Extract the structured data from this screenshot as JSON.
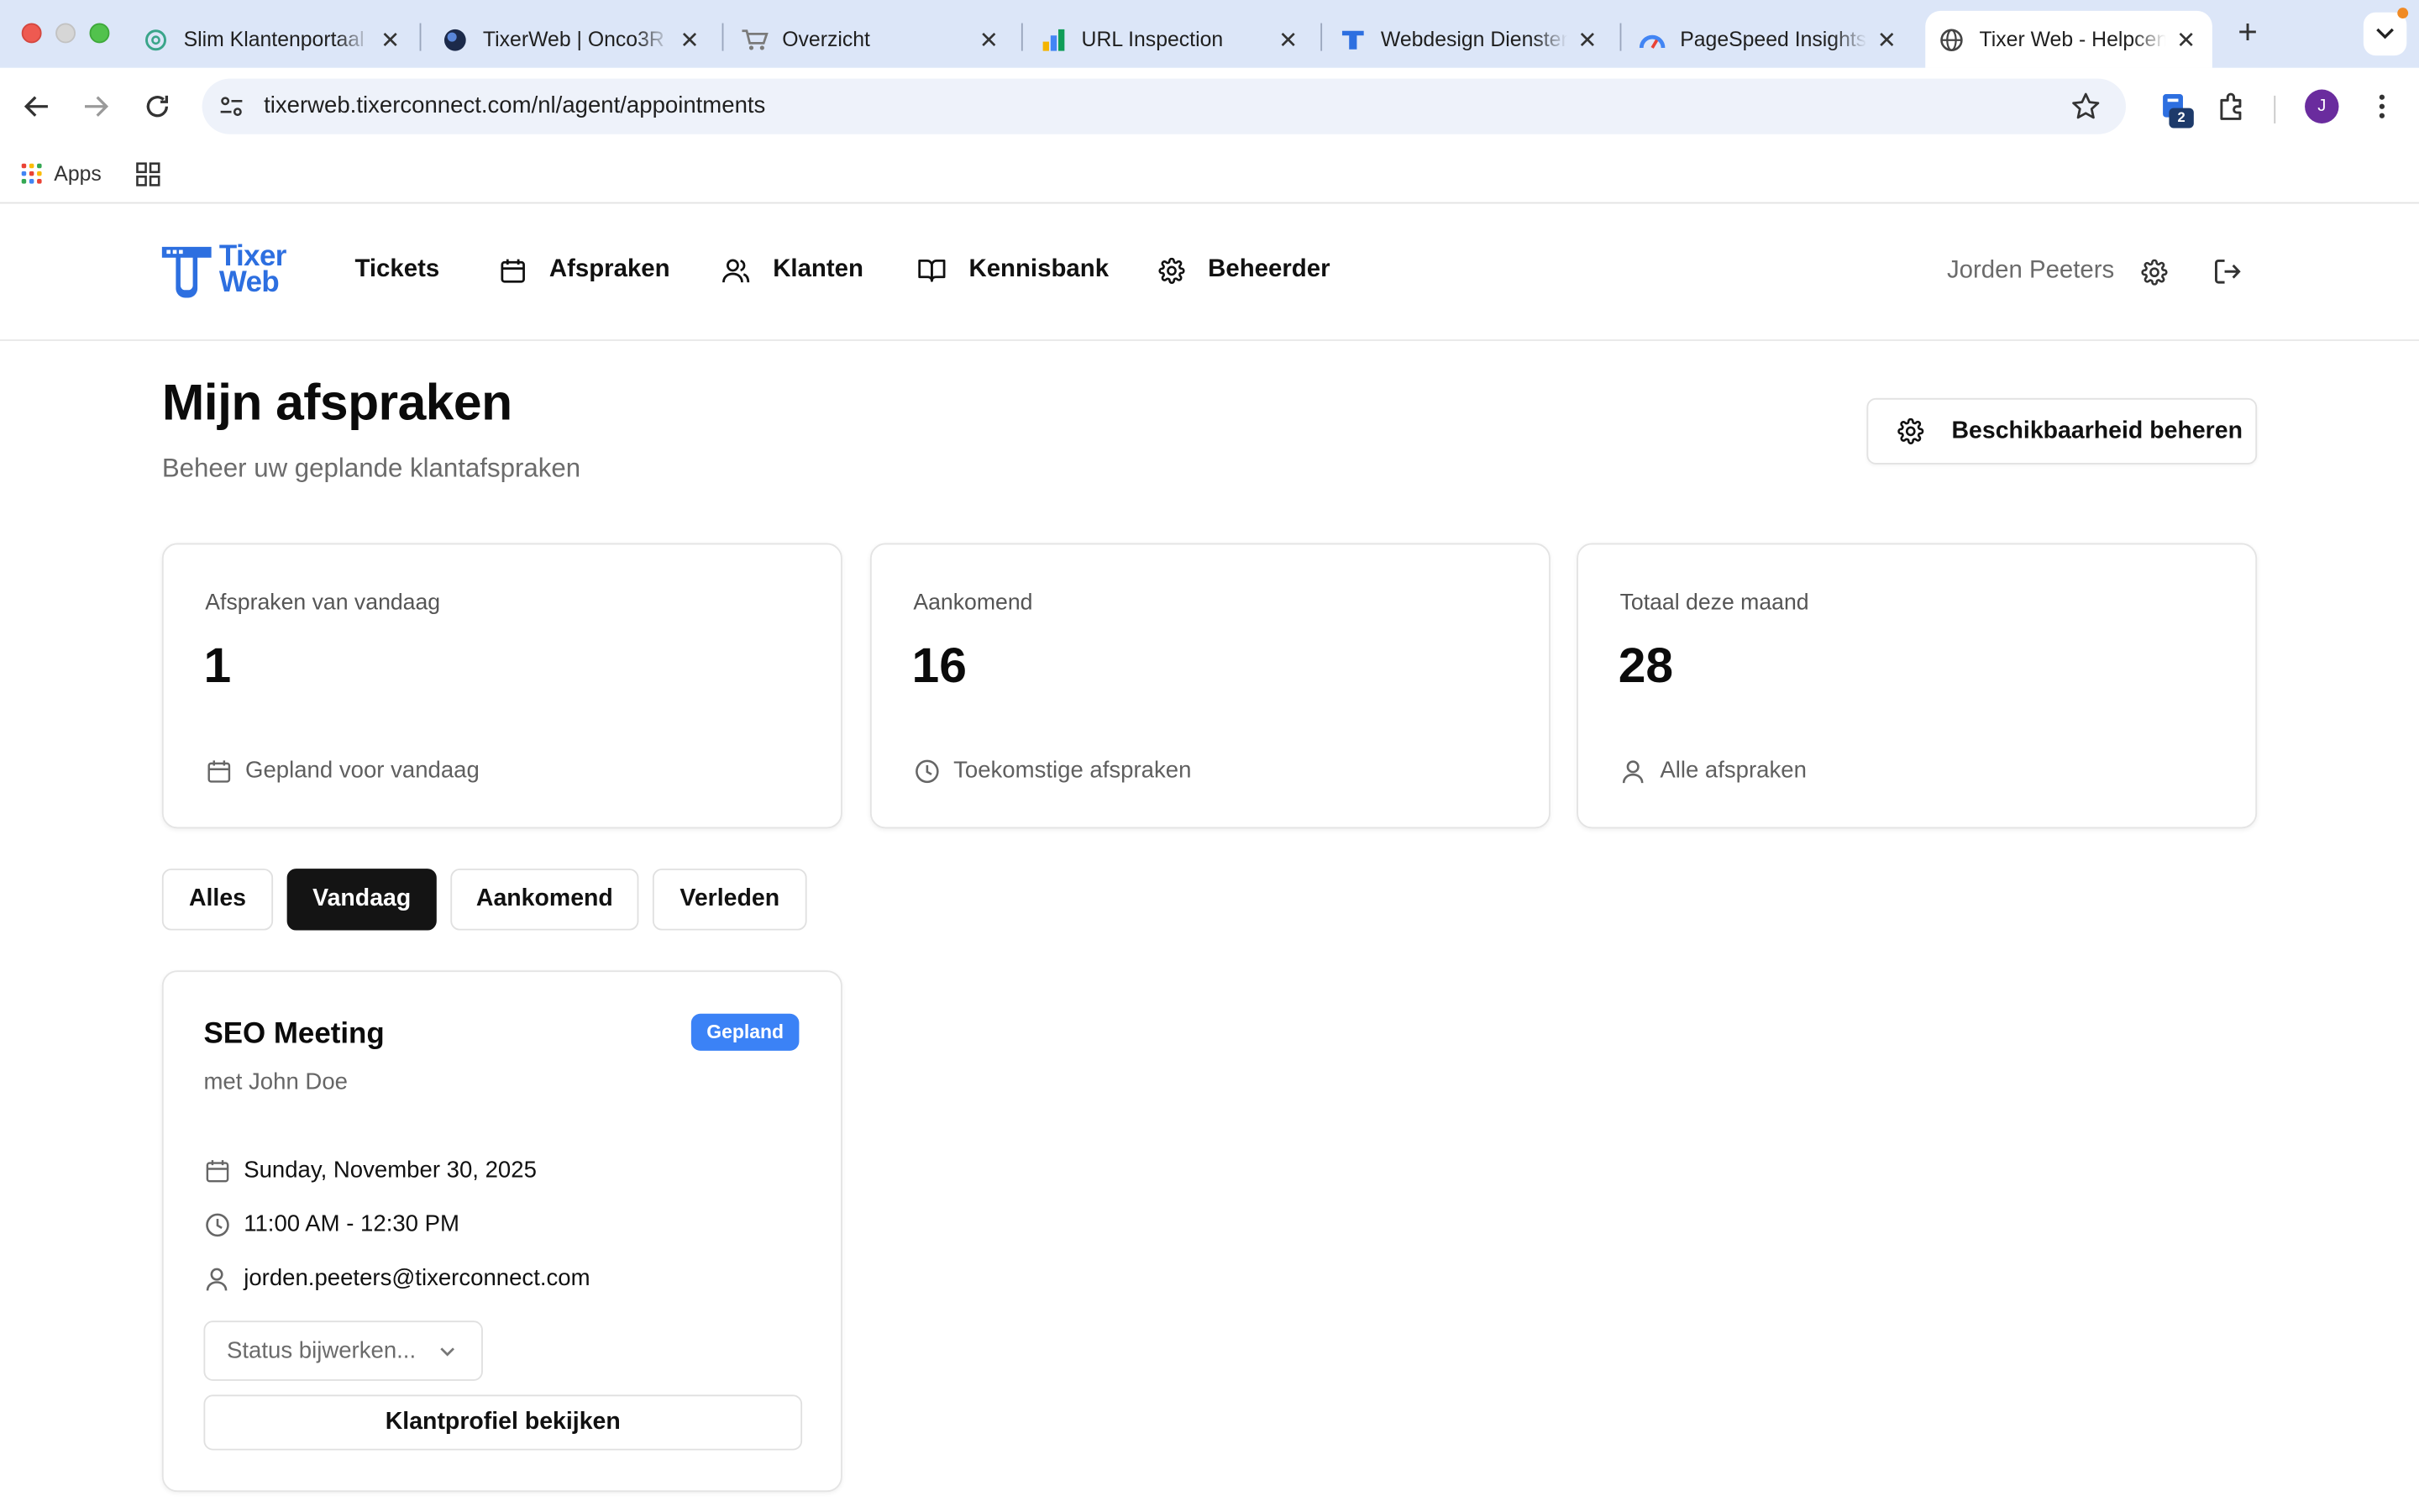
{
  "browser": {
    "tabs": [
      {
        "title": "Slim Klantenportaal",
        "favicon": "openai-icon"
      },
      {
        "title": "TixerWeb | Onco3R",
        "favicon": "globe-dark-icon"
      },
      {
        "title": "Overzicht",
        "favicon": "cart-icon"
      },
      {
        "title": "URL Inspection",
        "favicon": "search-console-icon"
      },
      {
        "title": "Webdesign Diensten",
        "favicon": "tixer-logo-icon"
      },
      {
        "title": "PageSpeed Insights",
        "favicon": "pagespeed-icon"
      },
      {
        "title": "Tixer Web - Helpcenter",
        "favicon": "globe-icon",
        "active": true
      }
    ],
    "url": "tixerweb.tixerconnect.com/nl/agent/appointments",
    "extension_badge": "2",
    "profile_initial": "J",
    "bookmarks": {
      "apps_label": "Apps"
    }
  },
  "app": {
    "logo_line1": "Tixer",
    "logo_line2": "Web",
    "nav": [
      {
        "label": "Tickets",
        "icon": ""
      },
      {
        "label": "Afspraken",
        "icon": "calendar-icon"
      },
      {
        "label": "Klanten",
        "icon": "users-icon"
      },
      {
        "label": "Kennisbank",
        "icon": "book-icon"
      },
      {
        "label": "Beheerder",
        "icon": "gear-icon"
      }
    ],
    "user_name": "Jorden Peeters"
  },
  "page": {
    "title": "Mijn afspraken",
    "subtitle": "Beheer uw geplande klantafspraken",
    "availability_button": "Beschikbaarheid beheren",
    "stats": [
      {
        "label": "Afspraken van vandaag",
        "value": "1",
        "footer": "Gepland voor vandaag",
        "icon": "calendar-icon"
      },
      {
        "label": "Aankomend",
        "value": "16",
        "footer": "Toekomstige afspraken",
        "icon": "clock-icon"
      },
      {
        "label": "Totaal deze maand",
        "value": "28",
        "footer": "Alle afspraken",
        "icon": "user-icon"
      }
    ],
    "filters": [
      {
        "label": "Alles",
        "active": false
      },
      {
        "label": "Vandaag",
        "active": true
      },
      {
        "label": "Aankomend",
        "active": false
      },
      {
        "label": "Verleden",
        "active": false
      }
    ],
    "appointment": {
      "title": "SEO Meeting",
      "badge": "Gepland",
      "with": "met John Doe",
      "date": "Sunday, November 30, 2025",
      "time": "11:00 AM - 12:30 PM",
      "email": "jorden.peeters@tixerconnect.com",
      "status_placeholder": "Status bijwerken...",
      "profile_button": "Klantprofiel bekijken"
    }
  },
  "colors": {
    "brand": "#2d6fe0",
    "badge": "#3b82f6",
    "active_filter": "#141414",
    "tabstrip": "#dce6f8"
  }
}
